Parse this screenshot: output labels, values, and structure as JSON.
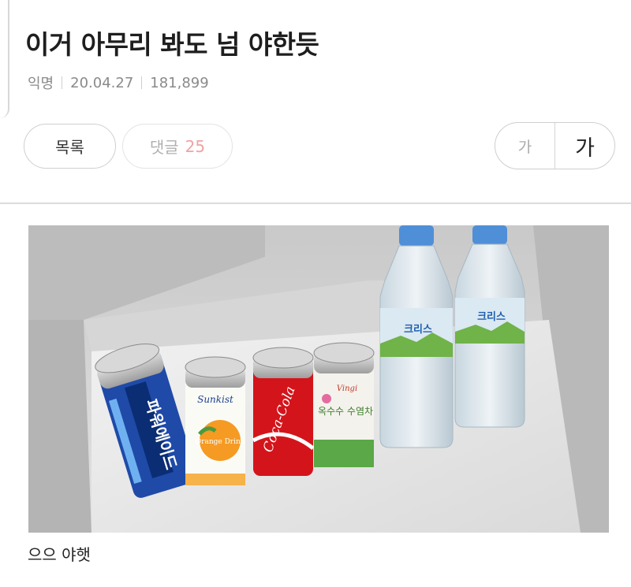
{
  "post": {
    "title": "이거 아무리 봐도 넘 야한듯",
    "author": "익명",
    "date": "20.04.27",
    "views": "181,899"
  },
  "actions": {
    "list_label": "목록",
    "comments_label": "댓글",
    "comments_count": "25",
    "font_small_label": "가",
    "font_large_label": "가"
  },
  "photo": {
    "can_labels": [
      "파워에이드",
      "Sunkist",
      "Orange Drink",
      "Coca-Cola",
      "Vingi",
      "옥수수 수염차"
    ],
    "bottle_labels": [
      "크리스",
      "크리스"
    ],
    "colors": {
      "powerade": "#1f4aa8",
      "sunkist": "#f59a23",
      "coke": "#d4141b",
      "corn_tea": "#5aa847",
      "bottle_cap": "#4f8fd8"
    }
  },
  "content": {
    "caption": "으으 야햇"
  }
}
